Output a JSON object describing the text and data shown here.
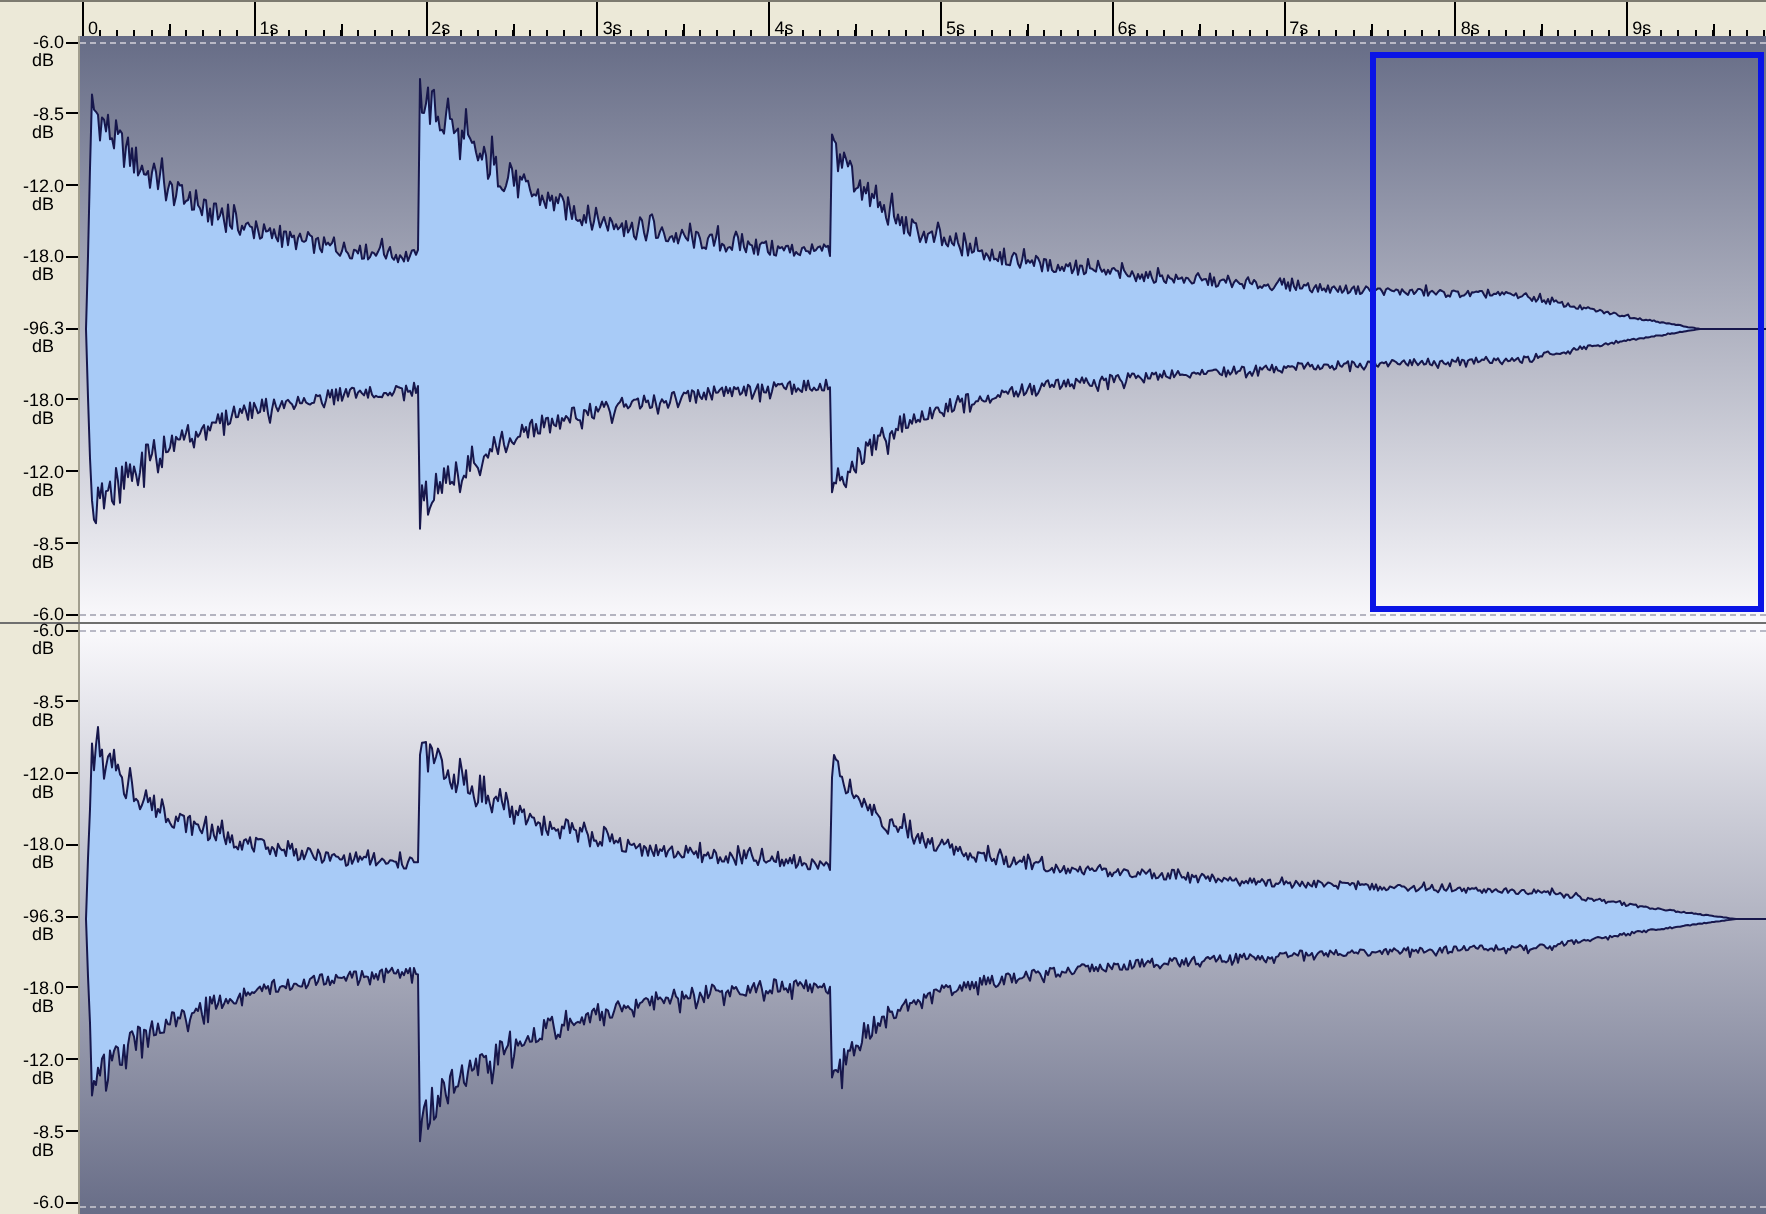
{
  "ruler": {
    "labels": [
      "0",
      "1s",
      "2s",
      "3s",
      "4s",
      "5s",
      "6s",
      "7s",
      "8s",
      "9s"
    ]
  },
  "tracks": [
    {
      "highlighted": true,
      "axis_labels": [
        {
          "value": "-6.0",
          "unit": "dB"
        },
        {
          "value": "-8.5",
          "unit": "dB"
        },
        {
          "value": "-12.0",
          "unit": "dB"
        },
        {
          "value": "-18.0",
          "unit": "dB"
        },
        {
          "value": "-96.3",
          "unit": "dB"
        },
        {
          "value": "-18.0",
          "unit": "dB"
        },
        {
          "value": "-12.0",
          "unit": "dB"
        },
        {
          "value": "-8.5",
          "unit": "dB"
        },
        {
          "value": "-6.0"
        }
      ]
    },
    {
      "highlighted": false,
      "axis_labels": [
        {
          "value": "-6.0",
          "unit": "dB"
        },
        {
          "value": "-8.5",
          "unit": "dB"
        },
        {
          "value": "-12.0",
          "unit": "dB"
        },
        {
          "value": "-18.0",
          "unit": "dB"
        },
        {
          "value": "-96.3",
          "unit": "dB"
        },
        {
          "value": "-18.0",
          "unit": "dB"
        },
        {
          "value": "-12.0",
          "unit": "dB"
        },
        {
          "value": "-8.5",
          "unit": "dB"
        },
        {
          "value": "-6.0"
        }
      ]
    }
  ]
}
